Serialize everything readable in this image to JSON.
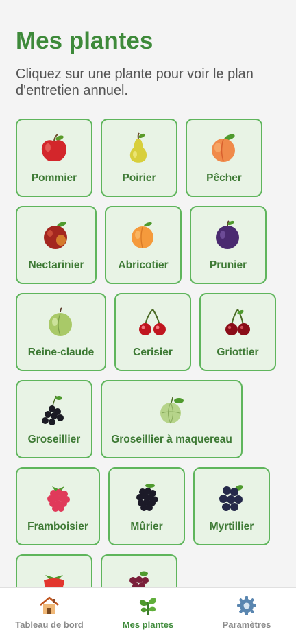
{
  "header": {
    "title": "Mes plantes",
    "subtitle": "Cliquez sur une plante pour voir le plan d'entretien annuel."
  },
  "plants": [
    {
      "label": "Pommier",
      "icon": "apple-icon"
    },
    {
      "label": "Poirier",
      "icon": "pear-icon"
    },
    {
      "label": "Pêcher",
      "icon": "peach-icon"
    },
    {
      "label": "Nectarinier",
      "icon": "nectarine-icon"
    },
    {
      "label": "Abricotier",
      "icon": "apricot-icon"
    },
    {
      "label": "Prunier",
      "icon": "plum-icon"
    },
    {
      "label": "Reine-claude",
      "icon": "greengage-icon"
    },
    {
      "label": "Cerisier",
      "icon": "cherry-icon"
    },
    {
      "label": "Griottier",
      "icon": "sour-cherry-icon"
    },
    {
      "label": "Groseillier",
      "icon": "blackcurrant-icon"
    },
    {
      "label": "Groseillier à maquereau",
      "icon": "gooseberry-icon"
    },
    {
      "label": "Framboisier",
      "icon": "raspberry-icon"
    },
    {
      "label": "Mûrier",
      "icon": "blackberry-icon"
    },
    {
      "label": "Myrtillier",
      "icon": "blueberry-icon"
    },
    {
      "label": "",
      "icon": "strawberry-icon"
    },
    {
      "label": "",
      "icon": "grapes-icon"
    }
  ],
  "tabs": [
    {
      "label": "Tableau de bord",
      "icon": "house-icon",
      "active": false
    },
    {
      "label": "Mes plantes",
      "icon": "plant-icon",
      "active": true
    },
    {
      "label": "Paramètres",
      "icon": "gear-icon",
      "active": false
    }
  ],
  "colors": {
    "accent": "#3e8a3a",
    "card_border": "#5fb55c",
    "card_background": "#e8f3e5",
    "inactive_tab": "#8a8a8a"
  }
}
